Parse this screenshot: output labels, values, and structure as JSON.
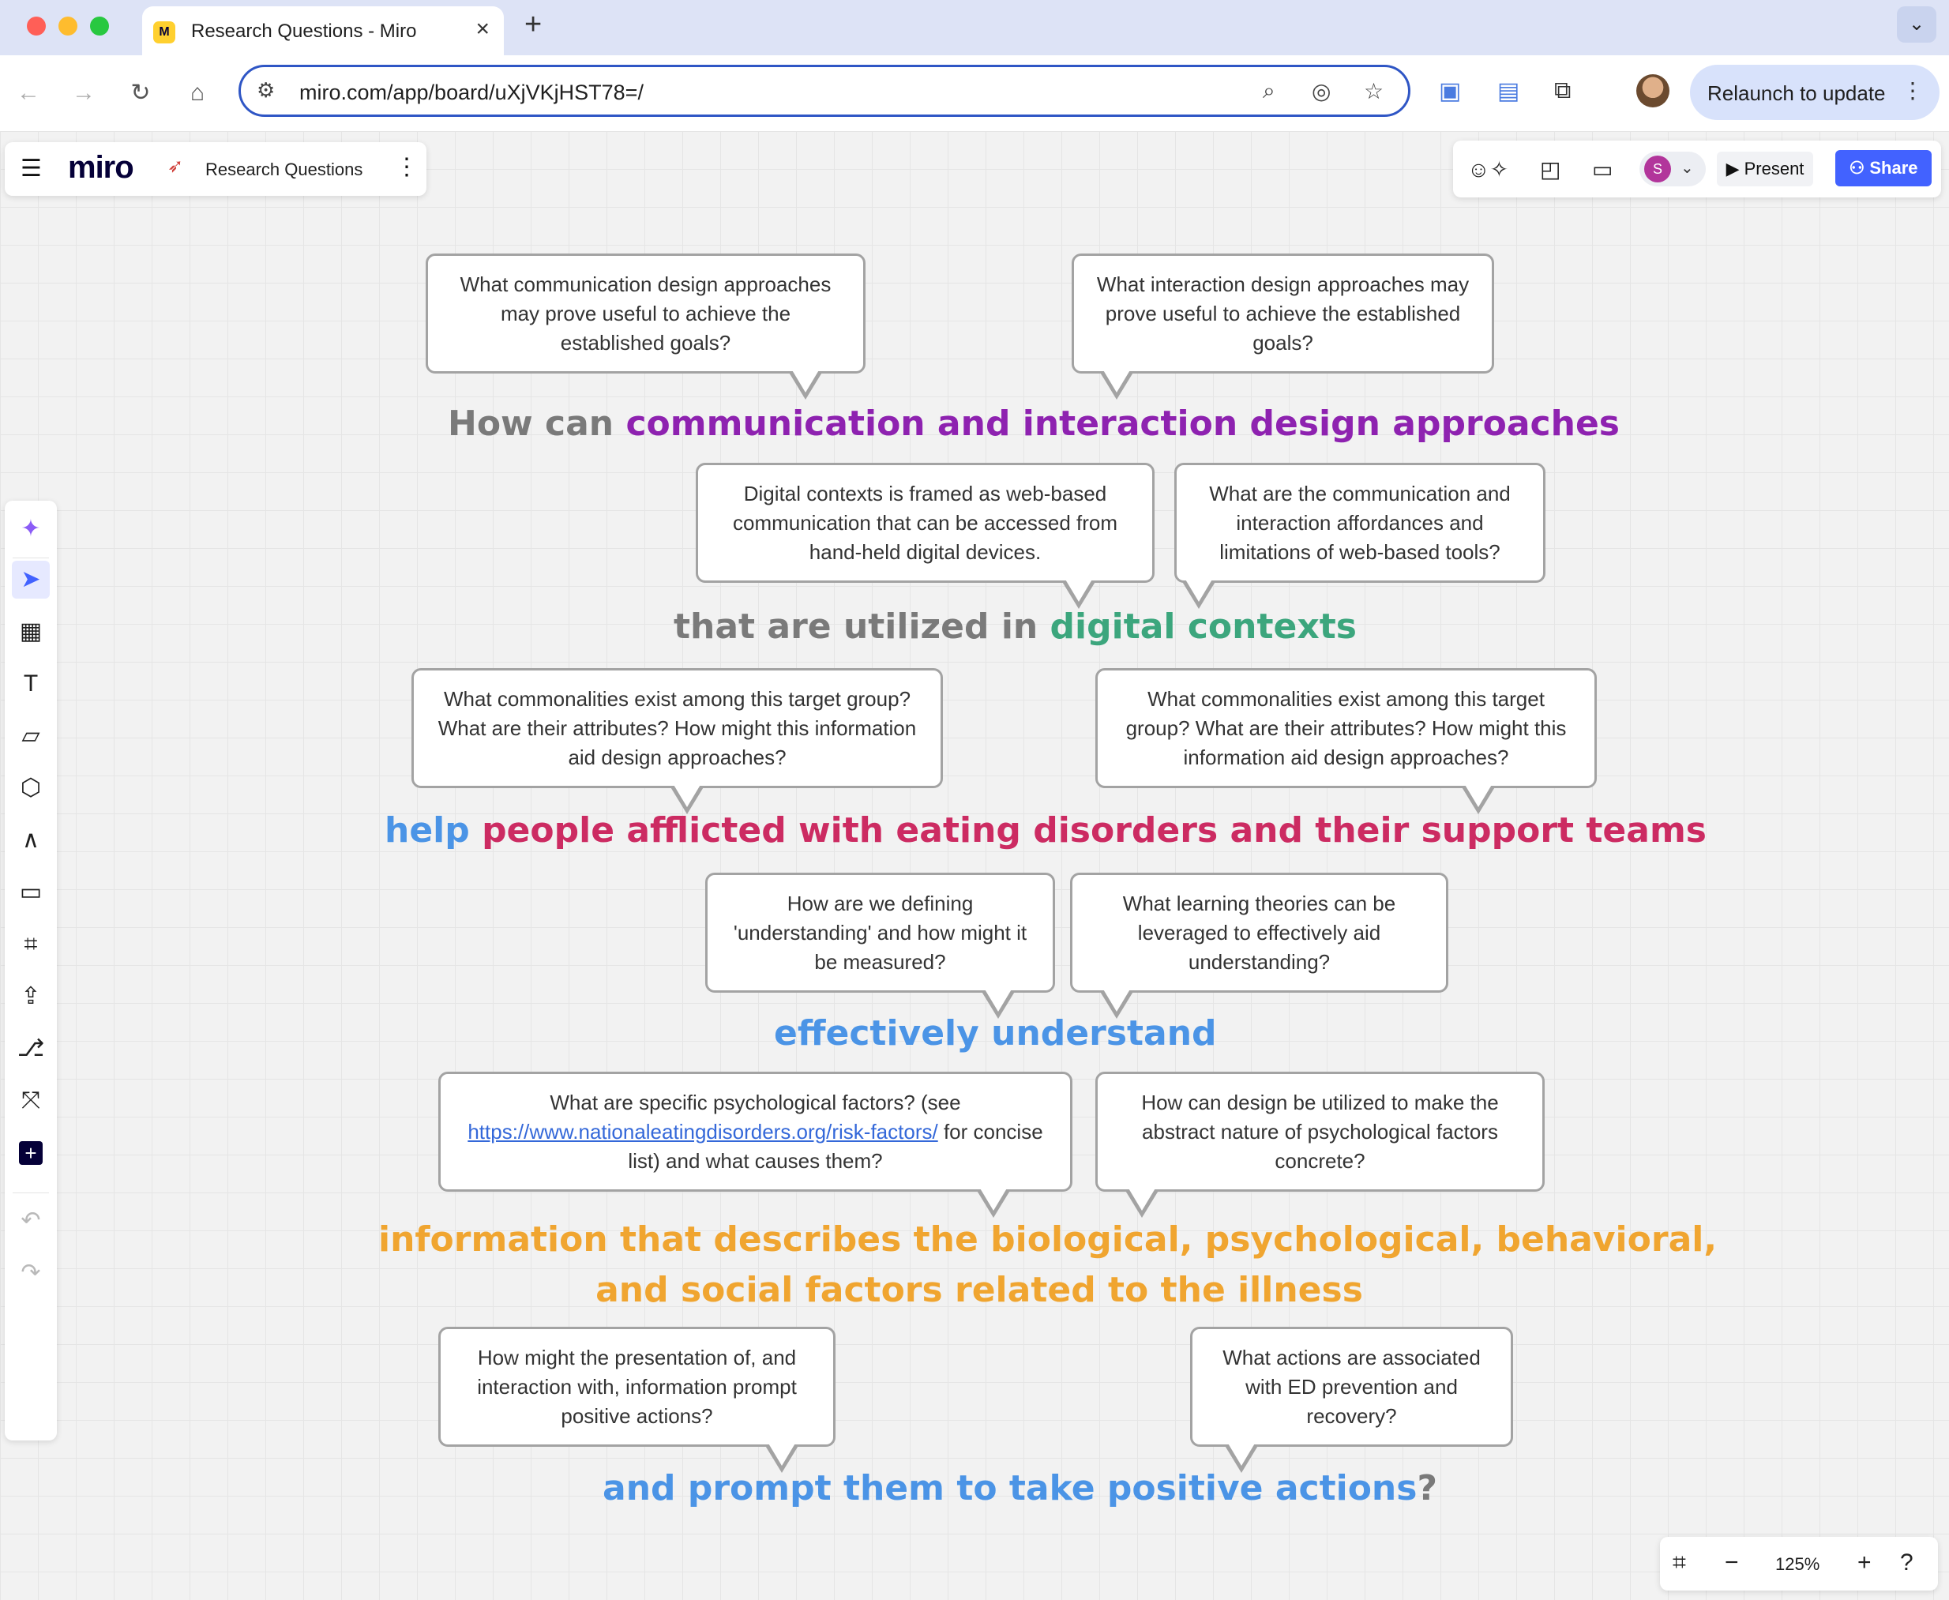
{
  "browser": {
    "tab_title": "Research Questions - Miro",
    "tab_new": "+",
    "url": "miro.com/app/board/uXjVKjHST78=/",
    "relaunch_label": "Relaunch to update"
  },
  "miro": {
    "logo": "miro",
    "board_name": "Research Questions",
    "present_label": "Present",
    "share_label": "Share",
    "user_initial": "S",
    "zoom_level": "125%",
    "accent_color": "#4262ff"
  },
  "board": {
    "phrases": {
      "p1_lead": "How can ",
      "p1_highlight": "communication and interaction design approaches",
      "p2_lead": "that are utilized in ",
      "p2_highlight": "digital contexts",
      "p3_lead": "help ",
      "p3_highlight": "people afflicted with eating disorders and their support teams",
      "p4": "effectively understand",
      "p5_line1": "information that describes the biological, psychological, behavioral,",
      "p5_line2": "and social factors related to the illness",
      "p6_main": "and prompt them to take positive actions",
      "p6_mark": "?"
    },
    "bubbles": {
      "comm_design": "What communication design approaches may prove useful to achieve the established goals?",
      "interaction_design": "What interaction design approaches may prove useful to achieve the established goals?",
      "digital_contexts": "Digital contexts is framed as  web-based communication that can be accessed from hand-held digital devices.",
      "affordances": "What are the communication and interaction affordances and limitations of web-based tools?",
      "commonalities_left": "What commonalities exist among this target group? What are their attributes? How might this information aid design approaches?",
      "commonalities_right": "What commonalities exist among this target group? What are their attributes? How might this information aid design approaches?",
      "defining_understanding": "How are we defining 'understanding' and how might it be measured?",
      "learning_theories": "What learning theories can be leveraged to effectively aid understanding?",
      "psych_factors_pre": "What are specific psychological factors? (see",
      "psych_factors_link": "https://www.nationaleatingdisorders.org/risk-factors/",
      "psych_factors_post": "for concise list) and what causes them?",
      "abstract_concrete": "How can design be utilized to make the abstract nature of psychological factors concrete?",
      "presentation_actions": "How might the presentation of, and interaction with, information prompt positive actions?",
      "ed_actions": "What actions are associated with ED prevention and recovery?"
    }
  }
}
